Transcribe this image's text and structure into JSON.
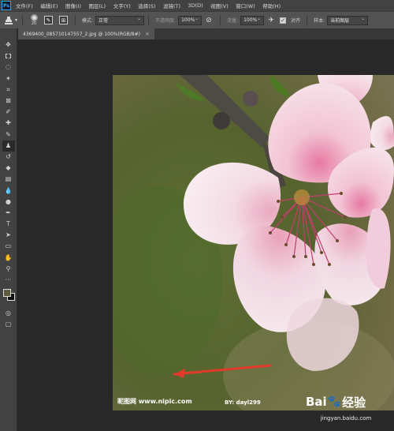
{
  "app": {
    "logo": "Ps"
  },
  "menubar": {
    "items": [
      "文件(F)",
      "编辑(E)",
      "图像(I)",
      "图层(L)",
      "文字(Y)",
      "选择(S)",
      "滤镜(T)",
      "3D(D)",
      "视图(V)",
      "窗口(W)",
      "帮助(H)"
    ]
  },
  "options_bar": {
    "tool_icon": "clone-stamp-icon",
    "brush_size": "20",
    "mode_label": "模式:",
    "mode_value": "正常",
    "opacity_label": "不透明度:",
    "opacity_value": "100%",
    "flow_label": "流量:",
    "flow_value": "100%",
    "aligned_label": "对齐",
    "aligned_checked": true,
    "sample_label": "样本:",
    "sample_value": "当前图层"
  },
  "toolbar": {
    "tools": [
      "move-icon",
      "marquee-icon",
      "lasso-icon",
      "magic-wand-icon",
      "crop-icon",
      "frame-icon",
      "eyedropper-icon",
      "healing-brush-icon",
      "brush-icon",
      "clone-stamp-icon",
      "history-brush-icon",
      "eraser-icon",
      "gradient-icon",
      "blur-icon",
      "dodge-icon",
      "pen-icon",
      "type-icon",
      "path-selection-icon",
      "rectangle-icon",
      "hand-icon",
      "zoom-icon",
      "more-tools-icon"
    ],
    "active_tool": "clone-stamp-icon",
    "foreground_color": "#5d5b3b",
    "background_color": "#111111"
  },
  "document": {
    "tab_title": "4369400_085710147557_2.jpg @ 100%(RGB/8#)",
    "tab_close": "×"
  },
  "image": {
    "watermark_site": "昵图网 www.nipic.com",
    "watermark_author": "BY: dayl299"
  },
  "overlay": {
    "baidu_logo_left": "Bai",
    "baidu_logo_right": "经验",
    "baidu_url": "jingyan.baidu.com",
    "arrow_color": "#e23a2a"
  }
}
